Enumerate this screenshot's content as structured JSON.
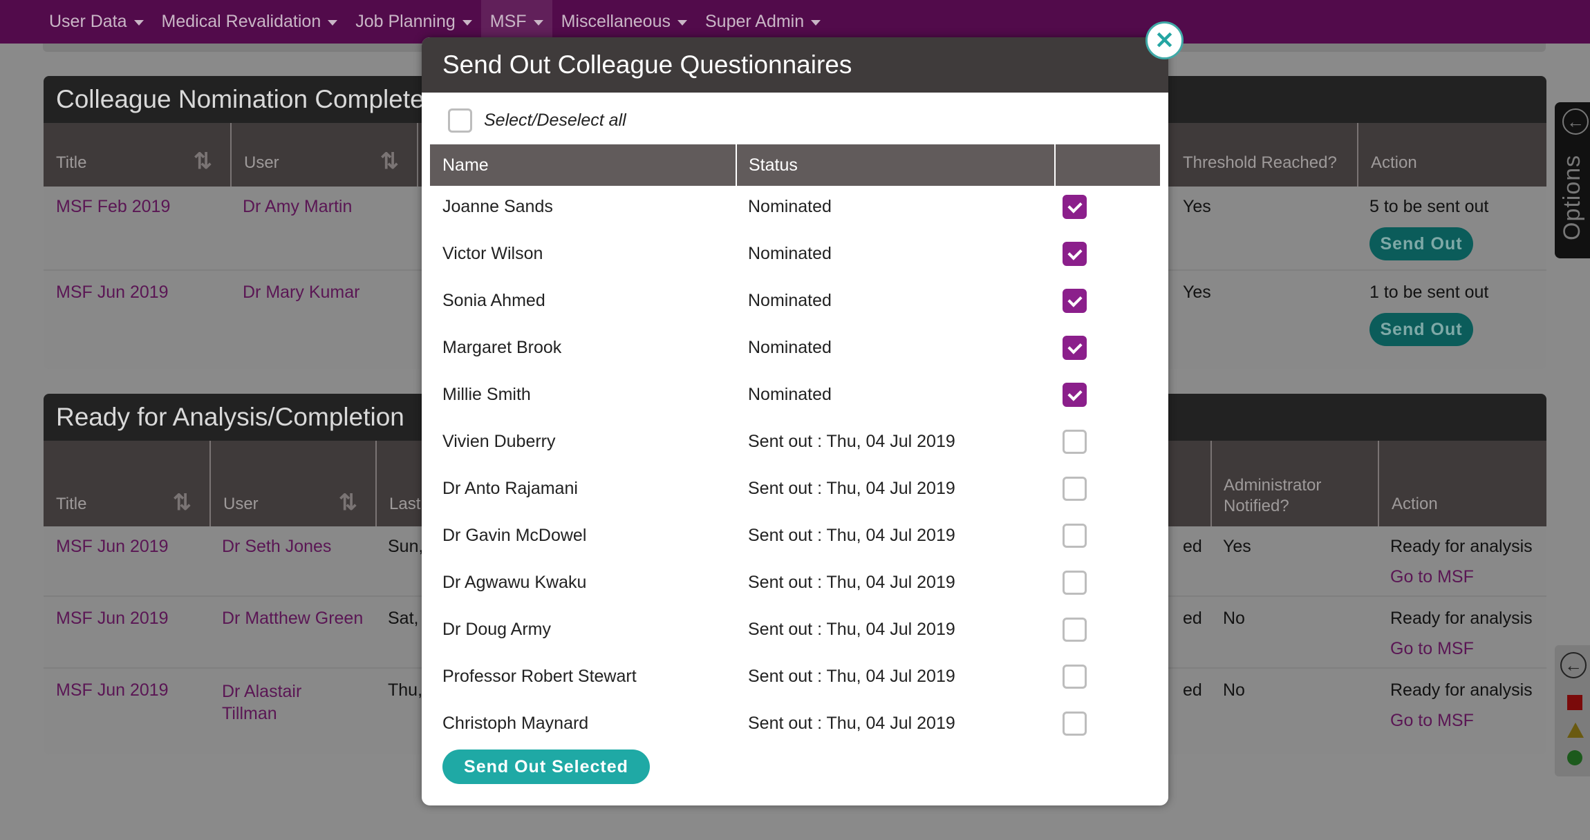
{
  "nav": {
    "items": [
      {
        "label": "User Data"
      },
      {
        "label": "Medical Revalidation"
      },
      {
        "label": "Job Planning"
      },
      {
        "label": "MSF"
      },
      {
        "label": "Miscellaneous"
      },
      {
        "label": "Super Admin"
      }
    ]
  },
  "nomination_panel": {
    "title": "Colleague Nomination Complete",
    "columns": {
      "title": "Title",
      "user": "User",
      "threshold": "Threshold Reached?",
      "action": "Action"
    },
    "rows": [
      {
        "title": "MSF Feb 2019",
        "user": "Dr Amy Martin",
        "threshold": "Yes",
        "action_text": "5 to be sent out",
        "button": "Send Out"
      },
      {
        "title": "MSF Jun 2019",
        "user": "Dr Mary Kumar",
        "threshold": "Yes",
        "action_text": "1 to be sent out",
        "button": "Send Out"
      }
    ]
  },
  "analysis_panel": {
    "title": "Ready for Analysis/Completion",
    "columns": {
      "title": "Title",
      "user": "User",
      "last": "Last",
      "admin_notified": "Administrator Notified?",
      "action": "Action"
    },
    "rows": [
      {
        "title": "MSF Jun 2019",
        "user": "Dr Seth Jones",
        "last": "Sun,",
        "partial": "ed",
        "notified": "Yes",
        "action_text": "Ready for analysis",
        "link": "Go to MSF"
      },
      {
        "title": "MSF Jun 2019",
        "user": "Dr Matthew Green",
        "last": "Sat,",
        "partial": "ed",
        "notified": "No",
        "action_text": "Ready for analysis",
        "link": "Go to MSF"
      },
      {
        "title": "MSF Jun 2019",
        "user": "Dr Alastair Tillman",
        "last": "Thu,",
        "partial": "ed",
        "notified": "No",
        "action_text": "Ready for analysis",
        "link": "Go to MSF"
      }
    ]
  },
  "options_tab": {
    "label": "Options"
  },
  "modal": {
    "title": "Send Out Colleague Questionnaires",
    "select_all_label": "Select/Deselect all",
    "columns": {
      "name": "Name",
      "status": "Status"
    },
    "rows": [
      {
        "name": "Joanne Sands",
        "status": "Nominated",
        "checked": true
      },
      {
        "name": "Victor Wilson",
        "status": "Nominated",
        "checked": true
      },
      {
        "name": "Sonia Ahmed",
        "status": "Nominated",
        "checked": true
      },
      {
        "name": "Margaret Brook",
        "status": "Nominated",
        "checked": true
      },
      {
        "name": "Millie Smith",
        "status": "Nominated",
        "checked": true
      },
      {
        "name": "Vivien Duberry",
        "status": "Sent out : Thu, 04 Jul 2019",
        "checked": false
      },
      {
        "name": "Dr Anto Rajamani",
        "status": "Sent out : Thu, 04 Jul 2019",
        "checked": false
      },
      {
        "name": "Dr Gavin McDowel",
        "status": "Sent out : Thu, 04 Jul 2019",
        "checked": false
      },
      {
        "name": "Dr Agwawu Kwaku",
        "status": "Sent out : Thu, 04 Jul 2019",
        "checked": false
      },
      {
        "name": "Dr Doug Army",
        "status": "Sent out : Thu, 04 Jul 2019",
        "checked": false
      },
      {
        "name": "Professor Robert Stewart",
        "status": "Sent out : Thu, 04 Jul 2019",
        "checked": false
      },
      {
        "name": "Christoph Maynard",
        "status": "Sent out : Thu, 04 Jul 2019",
        "checked": false
      }
    ],
    "send_button": "Send Out Selected",
    "close_icon": "close-icon"
  },
  "colors": {
    "nav": "#520b4b",
    "accent": "#1fa9a5",
    "checkbox": "#8b1f8b"
  }
}
